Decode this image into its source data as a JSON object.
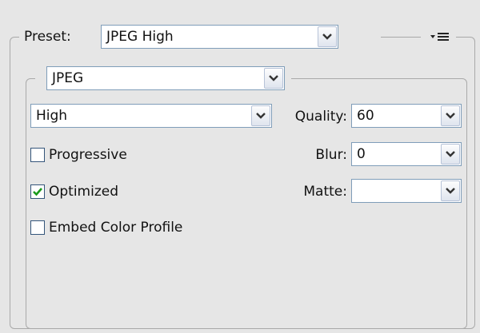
{
  "preset": {
    "label": "Preset:",
    "value": "JPEG High"
  },
  "format": {
    "value": "JPEG"
  },
  "compression": {
    "value": "High"
  },
  "quality": {
    "label": "Quality:",
    "value": "60"
  },
  "blur": {
    "label": "Blur:",
    "value": "0"
  },
  "matte": {
    "label": "Matte:",
    "value": ""
  },
  "options": [
    {
      "label": "Progressive",
      "checked": false
    },
    {
      "label": "Optimized",
      "checked": true
    },
    {
      "label": "Embed Color Profile",
      "checked": false
    }
  ],
  "icons": {
    "dropdown": "chevron-down-icon",
    "panel_menu": "panel-menu-icon",
    "check": "checkmark-icon"
  },
  "colors": {
    "background": "#e6e6e6",
    "field_border": "#7f9db9",
    "check": "#1a9b1a"
  }
}
